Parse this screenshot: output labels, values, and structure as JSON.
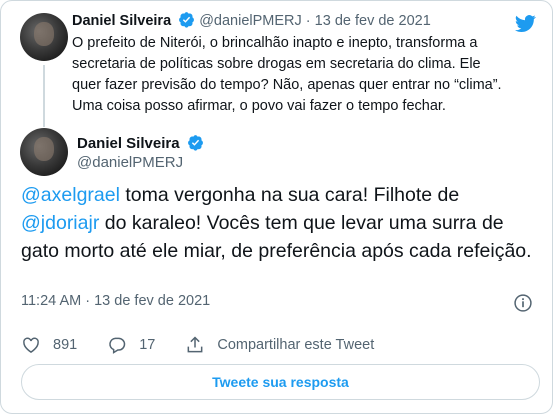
{
  "parent_tweet": {
    "name": "Daniel Silveira",
    "handle": "@danielPMERJ",
    "separator": "·",
    "date": "13 de fev de 2021",
    "text": "O prefeito de Niterói, o brincalhão inapto e inepto, transforma a secretaria de políticas sobre drogas em secretaria do clima. Ele quer fazer previsão do tempo? Não, apenas quer entrar no “clima”. Uma coisa posso afirmar, o povo vai fazer o tempo fechar."
  },
  "main_tweet": {
    "name": "Daniel Silveira",
    "handle": "@danielPMERJ",
    "text_segments": {
      "mention1": "@axelgrael",
      "text1": " toma vergonha na sua cara! Filhote de ",
      "mention2": "@jdoriajr",
      "text2": " do karaleo! Vocês tem que levar uma surra de gato morto até ele miar, de preferência após cada refeição."
    },
    "time": "11:24 AM",
    "separator": "·",
    "date": "13 de fev de 2021"
  },
  "actions": {
    "likes": "891",
    "replies": "17",
    "share_label": "Compartilhar este Tweet"
  },
  "reply_button_label": "Tweete sua resposta",
  "colors": {
    "accent": "#1d9bf0",
    "text": "#0f1419",
    "secondary": "#536471",
    "border": "#cfd9de"
  }
}
